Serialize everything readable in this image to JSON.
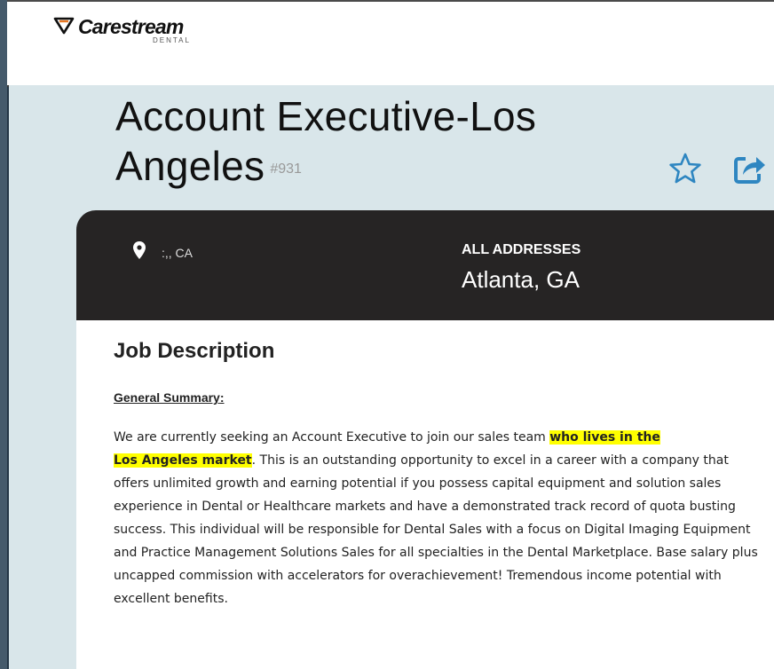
{
  "brand": {
    "name": "Carestream",
    "sub": "DENTAL"
  },
  "job": {
    "title_line1": "Account Executive-Los",
    "title_line2": "Angeles",
    "number": "#931"
  },
  "location": {
    "city_state": ":,, CA",
    "addresses_label": "ALL ADDRESSES",
    "address_value": "Atlanta, GA"
  },
  "description": {
    "heading": "Job Description",
    "summary_label": "General Summary",
    "summary_colon": ":",
    "p1_before": "We are currently seeking an Account Executive to join our sales team ",
    "p1_highlight_a": "who lives in the",
    "p1_highlight_b": "Los Angeles market",
    "p1_dot": ".",
    "p1_rest": " This is an outstanding opportunity to excel in a career with a company that offers unlimited growth and earning potential if you possess capital equipment and solution sales experience in Dental or Healthcare markets and have a demonstrated track record of quota busting success. This individual will be responsible for Dental Sales with a focus on Digital Imaging Equipment and Practice Management Solutions Sales for all specialties in the Dental Marketplace. Base salary plus uncapped commission with accelerators for overachievement! Tremendous income potential with",
    "p1_end": "excellent benefits."
  },
  "colors": {
    "accent_blue": "#2e86c1",
    "panel_bg": "#d9e6ea",
    "info_bar": "#262424",
    "highlight": "#ffff00"
  },
  "icons": {
    "favorite": "star-outline-icon",
    "share": "share-icon",
    "location": "map-pin-icon"
  }
}
